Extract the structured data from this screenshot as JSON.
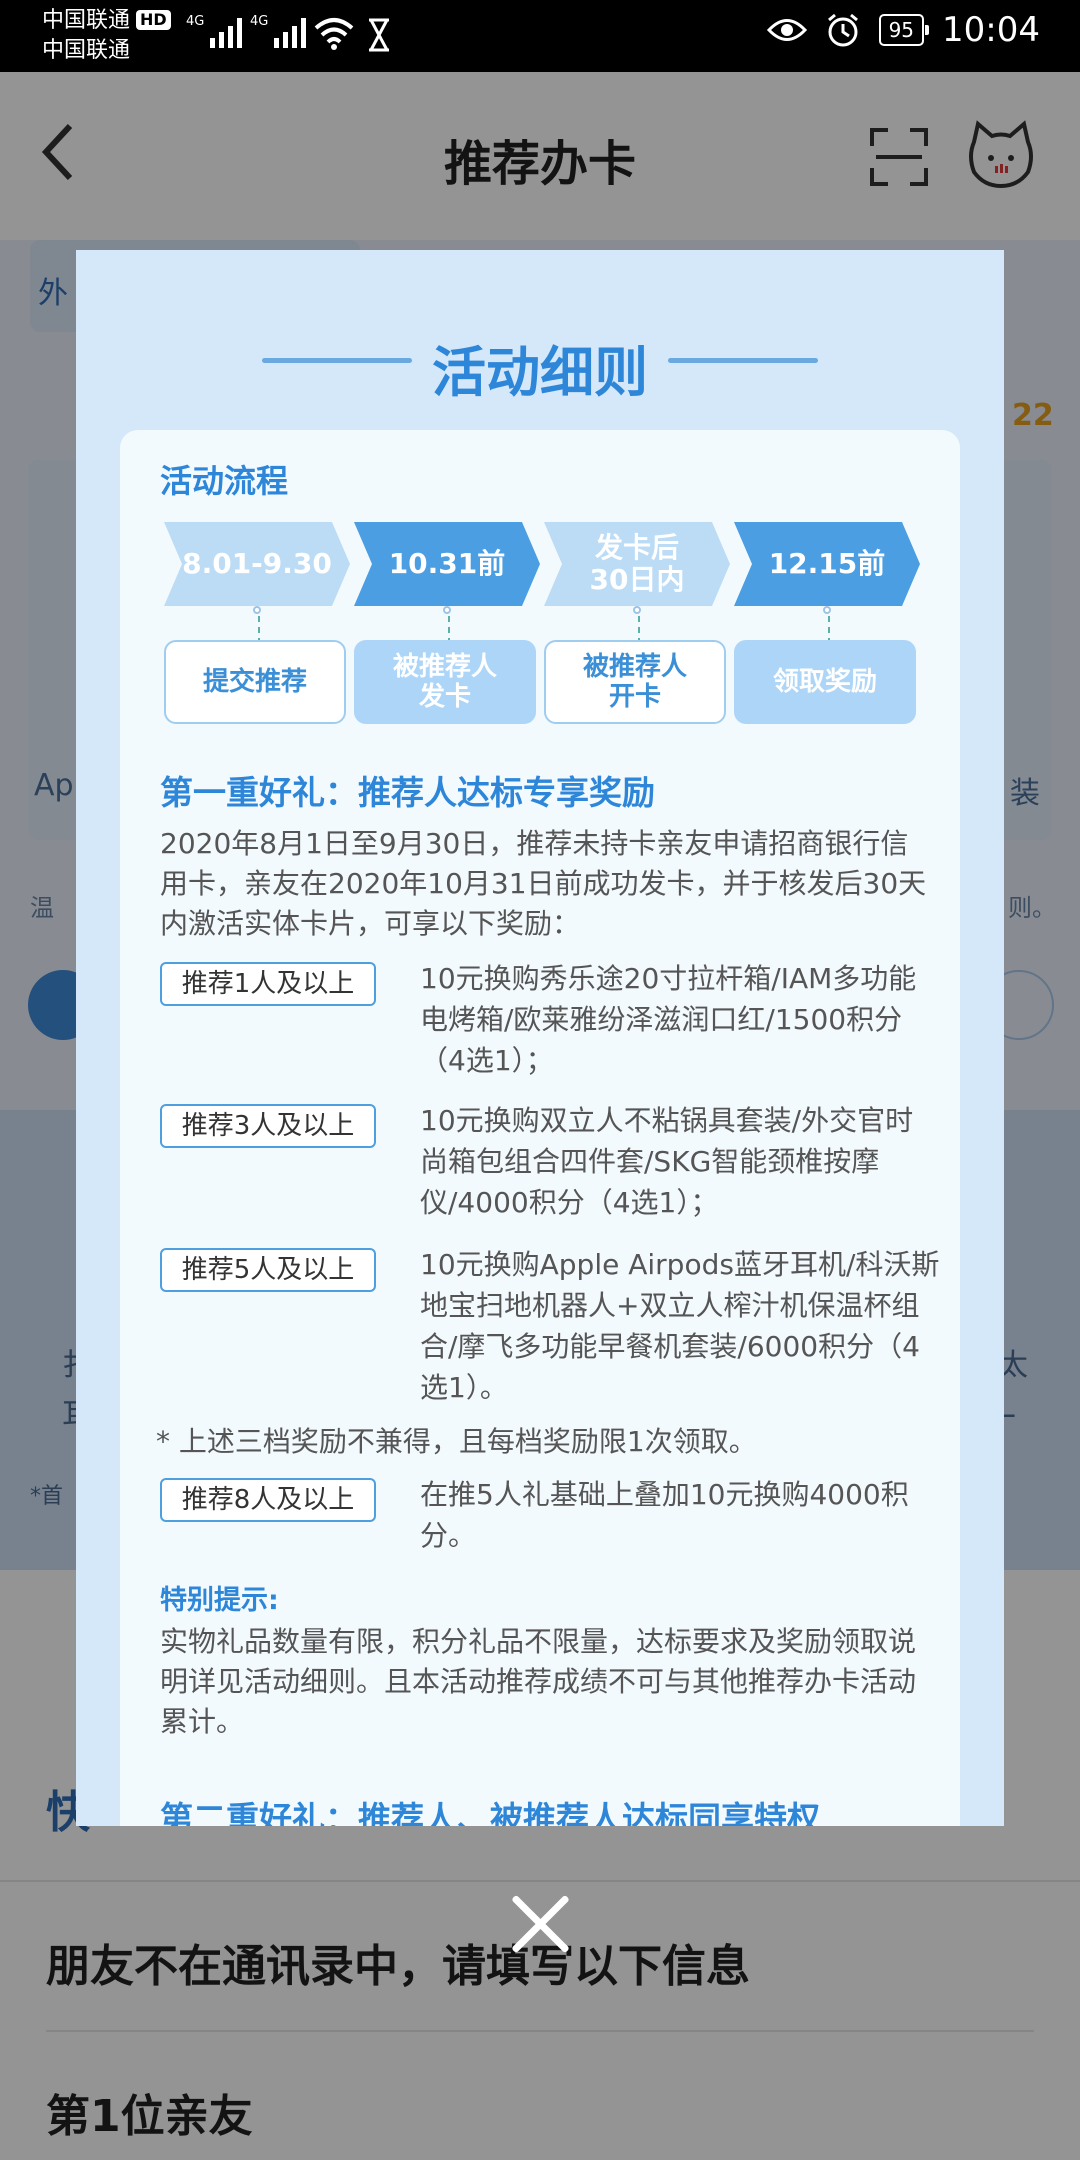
{
  "status_bar": {
    "carrier_1": "中国联通",
    "carrier_hd": "HD",
    "carrier_2": "中国联通",
    "network_1": "4G",
    "network_2": "4G",
    "battery": "95",
    "time": "10:04"
  },
  "header": {
    "title": "推荐办卡"
  },
  "background": {
    "tab_fragment": "外",
    "badge_fragment": "22",
    "side_left": "Ap",
    "side_right": "装",
    "notice_fragment": "温",
    "notice_right": "则。",
    "band_left_1": "扌",
    "band_left_2": "耳",
    "band_right_1": "太",
    "band_right_2": "L",
    "footnote_fragment": "*首",
    "section_fragment": "快",
    "friends_prompt": "朋友不在通讯录中，请填写以下信息",
    "friend_1": "第1位亲友"
  },
  "modal": {
    "title": "活动细则",
    "process_title": "活动流程",
    "steps": [
      {
        "date": "8.01-9.30",
        "action": "提交推荐"
      },
      {
        "date": "10.31前",
        "action": "被推荐人发卡"
      },
      {
        "date": "发卡后30日内",
        "action": "被推荐人开卡"
      },
      {
        "date": "12.15前",
        "action": "领取奖励"
      }
    ],
    "first_gift_title": "第一重好礼：推荐人达标专享奖励",
    "first_gift_desc": "2020年8月1日至9月30日，推荐未持卡亲友申请招商银行信用卡，亲友在2020年10月31日前成功发卡，并于核发后30天内激活实体卡片，可享以下奖励：",
    "tiers": [
      {
        "tag": "推荐1人及以上",
        "reward": "10元换购秀乐途20寸拉杆箱/IAM多功能电烤箱/欧莱雅纷泽滋润口红/1500积分（4选1）；"
      },
      {
        "tag": "推荐3人及以上",
        "reward": "10元换购双立人不粘锅具套装/外交官时尚箱包组合四件套/SKG智能颈椎按摩仪/4000积分（4选1）；"
      },
      {
        "tag": "推荐5人及以上",
        "reward": "10元换购Apple Airpods蓝牙耳机/科沃斯地宝扫地机器人+双立人榨汁机保温杯组合/摩飞多功能早餐机套装/6000积分（4选1）。"
      }
    ],
    "tier_note": "* 上述三档奖励不兼得，且每档奖励限1次领取。",
    "tier_8": {
      "tag": "推荐8人及以上",
      "reward": "在推5人礼基础上叠加10元换购4000积分。"
    },
    "special_title": "特别提示:",
    "special_desc": "实物礼品数量有限，积分礼品不限量，达标要求及奖励领取说明详见活动细则。且本活动推荐成绩不可与其他推荐办卡活动累计。",
    "second_gift_title": "第二重好礼：推荐人、被推荐人达标同享特权"
  },
  "colors": {
    "accent": "#2e86d8",
    "modal_bg": "#d5e8fa",
    "panel_bg": "#f3fafe",
    "arrow_light": "#bcdcf6",
    "arrow_dark": "#4b9ee2"
  }
}
